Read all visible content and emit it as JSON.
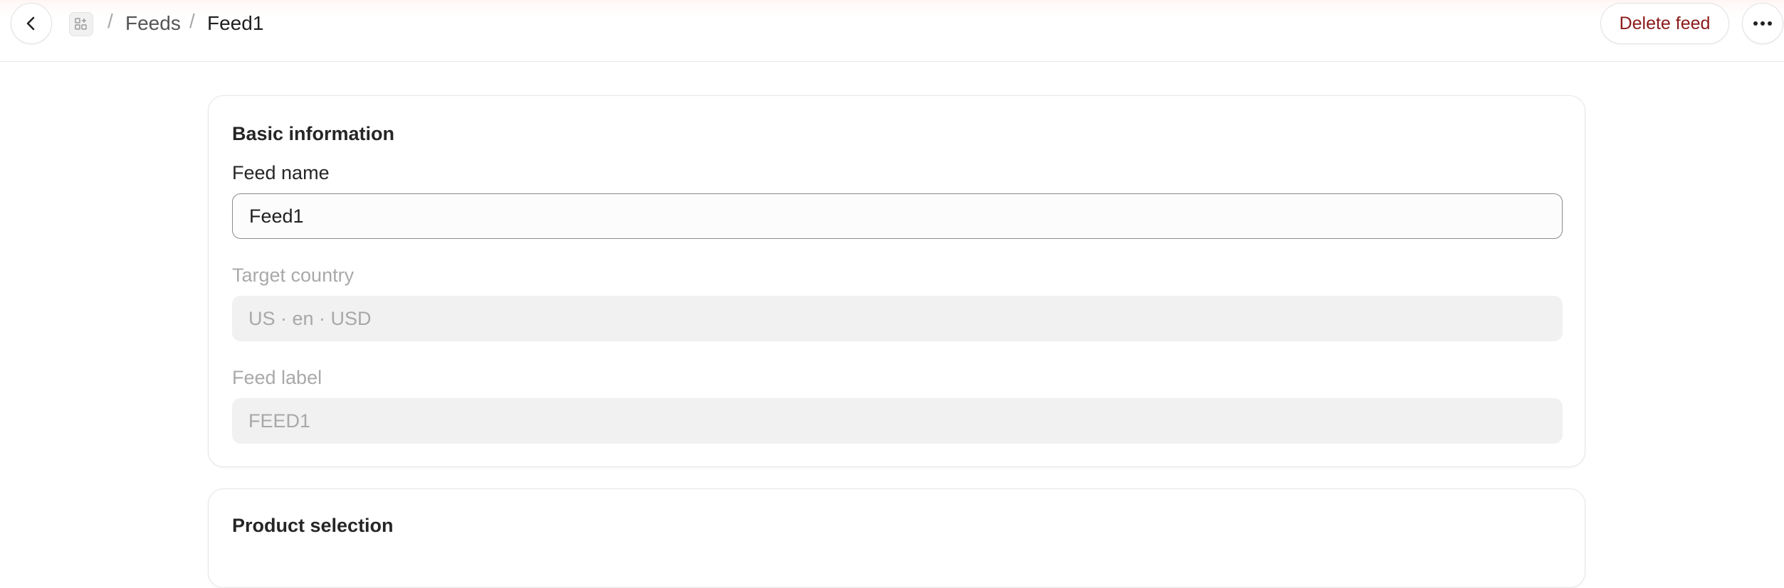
{
  "header": {
    "breadcrumb": {
      "feeds": "Feeds",
      "current": "Feed1"
    },
    "separator": "/",
    "delete_label": "Delete feed"
  },
  "basic_info": {
    "title": "Basic information",
    "feed_name": {
      "label": "Feed name",
      "value": "Feed1"
    },
    "target_country": {
      "label": "Target country",
      "value": "US · en · USD"
    },
    "feed_label": {
      "label": "Feed label",
      "value": "FEED1"
    }
  },
  "product_selection": {
    "title": "Product selection"
  },
  "colors": {
    "danger_text": "#8b1a1a",
    "muted_text": "#a9a9a9",
    "disabled_bg": "#f1f1f1"
  },
  "icons": {
    "back": "chevron-left-icon",
    "app": "apps-grid-icon",
    "more": "more-horizontal-icon"
  }
}
